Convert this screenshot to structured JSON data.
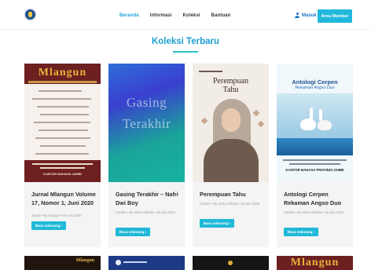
{
  "header": {
    "nav": [
      "Beranda",
      "Informasi",
      "Koleksi",
      "Bantuan"
    ],
    "active_index": 0,
    "login_label": "Masuk",
    "member_button": "Area Member"
  },
  "section": {
    "title": "Koleksi Terbaru"
  },
  "cards": [
    {
      "title": "Jurnal Mlangun Volume 17, Nomor 1, Juni 2020",
      "meta": "Jurnal • By ricaayal • 15 Juni 2020",
      "read_label": "Baca sekarang ›",
      "cover": {
        "masthead": "Mlangun",
        "publisher": "KANTOR BAHASA JAMBI",
        "accent_color": "#6e1f20"
      }
    },
    {
      "title": "Gasing Terakhir – Nafri Dwi Boy",
      "meta": "Cerpen • By anisa sofiana • 15 Juni 2020",
      "read_label": "Baca sekarang ›",
      "cover": {
        "line1": "Gasing",
        "line2": "Terakhir"
      }
    },
    {
      "title": "Perempuan Tahu",
      "meta": "Cerpen • By anisa sofiana • 15 Juni 2020",
      "read_label": "Baca sekarang ›",
      "cover": {
        "line1": "Perempuan",
        "line2": "Tahu"
      }
    },
    {
      "title": "Antologi Cerpen Rekaman Angso Duo",
      "meta": "Cerpen • By anisa sofiana • 15 Juni 2020",
      "read_label": "Baca sekarang ›",
      "cover": {
        "title": "Antologi Cerpen",
        "subtitle": "Rekaman Angso Duo",
        "publisher": "KANTOR BAHASA PROVINSI JAMBI"
      }
    }
  ],
  "second_row": [
    {
      "label": "Mlangun"
    },
    {
      "label": ""
    },
    {
      "label": ""
    },
    {
      "label": "Mlangun"
    }
  ],
  "colors": {
    "accent": "#1aa2d9",
    "button": "#1fb9d8",
    "card_bg": "#f4f4f5"
  }
}
